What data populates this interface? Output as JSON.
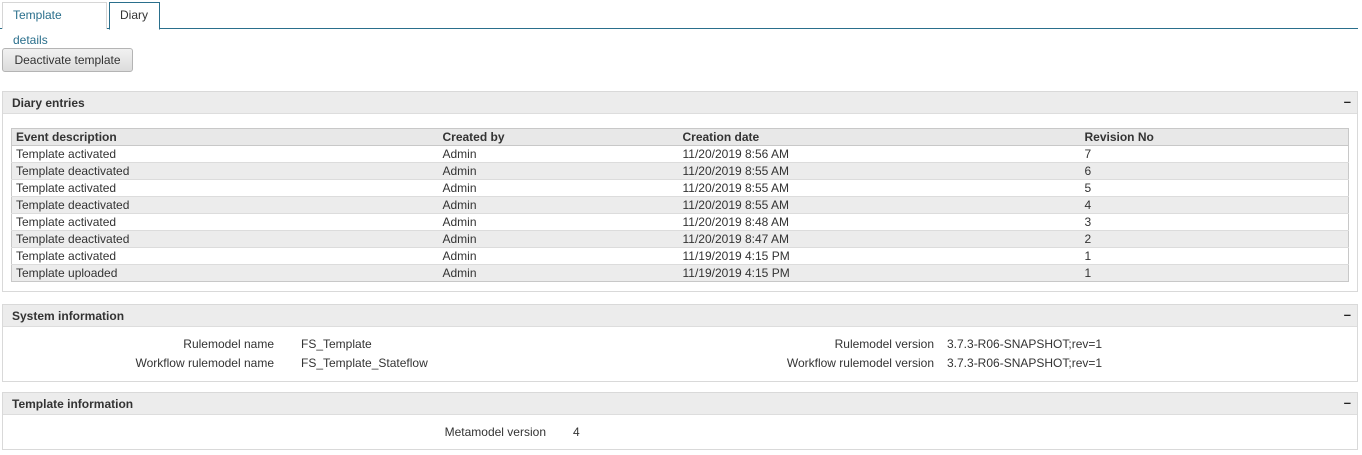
{
  "tabs": [
    {
      "label": "Template details"
    },
    {
      "label": "Diary"
    }
  ],
  "actions": {
    "deactivate_label": "Deactivate template"
  },
  "diary": {
    "title": "Diary entries",
    "collapse": "–",
    "columns": [
      "Event description",
      "Created by",
      "Creation date",
      "Revision No"
    ],
    "rows": [
      [
        "Template activated",
        "Admin",
        "11/20/2019 8:56 AM",
        "7"
      ],
      [
        "Template deactivated",
        "Admin",
        "11/20/2019 8:55 AM",
        "6"
      ],
      [
        "Template activated",
        "Admin",
        "11/20/2019 8:55 AM",
        "5"
      ],
      [
        "Template deactivated",
        "Admin",
        "11/20/2019 8:55 AM",
        "4"
      ],
      [
        "Template activated",
        "Admin",
        "11/20/2019 8:48 AM",
        "3"
      ],
      [
        "Template deactivated",
        "Admin",
        "11/20/2019 8:47 AM",
        "2"
      ],
      [
        "Template activated",
        "Admin",
        "11/19/2019 4:15 PM",
        "1"
      ],
      [
        "Template uploaded",
        "Admin",
        "11/19/2019 4:15 PM",
        "1"
      ]
    ]
  },
  "system": {
    "title": "System information",
    "collapse": "–",
    "rulemodel_name_label": "Rulemodel name",
    "rulemodel_name": "FS_Template",
    "workflow_rulemodel_name_label": "Workflow rulemodel name",
    "workflow_rulemodel_name": "FS_Template_Stateflow",
    "rulemodel_version_label": "Rulemodel version",
    "rulemodel_version": "3.7.3-R06-SNAPSHOT;rev=1",
    "workflow_rulemodel_version_label": "Workflow rulemodel version",
    "workflow_rulemodel_version": "3.7.3-R06-SNAPSHOT;rev=1"
  },
  "template_info": {
    "title": "Template information",
    "collapse": "–",
    "metamodel_version_label": "Metamodel version",
    "metamodel_version": "4"
  }
}
